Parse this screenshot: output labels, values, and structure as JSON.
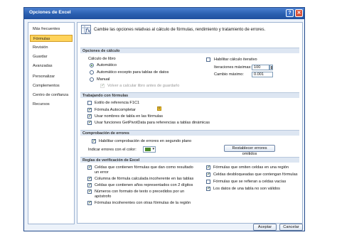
{
  "window": {
    "title": "Opciones de Excel",
    "help_icon": "?",
    "close_icon": "✕"
  },
  "sidebar": {
    "items": [
      {
        "label": "Más frecuentes"
      },
      {
        "label": "Fórmulas"
      },
      {
        "label": "Revisión"
      },
      {
        "label": "Guardar"
      },
      {
        "label": "Avanzadas"
      },
      {
        "label": "Personalizar"
      },
      {
        "label": "Complementos"
      },
      {
        "label": "Centro de confianza"
      },
      {
        "label": "Recursos"
      }
    ]
  },
  "header": {
    "text": "Cambie las opciones relativas al cálculo de fórmulas, rendimiento y tratamiento de errores."
  },
  "calc": {
    "section": "Opciones de cálculo",
    "group_label": "Cálculo de libro",
    "auto": "Automático",
    "auto_except": "Automático excepto para tablas de datos",
    "manual": "Manual",
    "recalc": "Volver a calcular libro antes de guardarlo",
    "iterative": "Habilitar cálculo iterativo",
    "max_iter_label": "Iteraciones máximas:",
    "max_iter_value": "100",
    "max_change_label": "Cambio máximo:",
    "max_change_value": "0.001"
  },
  "formulas": {
    "section": "Trabajando con fórmulas",
    "items": [
      {
        "label": "Estilo de referencia F1C1",
        "checked": false
      },
      {
        "label": "Fórmula Autocompletar",
        "checked": true
      },
      {
        "label": "Usar nombres de tabla en las fórmulas",
        "checked": true
      },
      {
        "label": "Usar funciones GetPivotData para referencias a tablas dinámicas",
        "checked": true
      }
    ]
  },
  "errors": {
    "section": "Comprobación de errores",
    "enable": "Habilitar comprobación de errores en segundo plano",
    "color_label": "Indicar errores con el color:",
    "reset_button": "Restablecer errores omitidos"
  },
  "rules": {
    "section": "Reglas de verificación de Excel",
    "left": [
      {
        "label": "Celdas que contienen fórmulas que dan como resultado",
        "label2": "un error",
        "checked": true
      },
      {
        "label": "Columna de fórmula calculada incoherente en las tablas",
        "checked": true
      },
      {
        "label": "Celdas que contienen años representados con 2 dígitos",
        "checked": true
      },
      {
        "label": "Números con formato de texto o precedidos por un",
        "label2": "apóstrofo",
        "checked": true
      },
      {
        "label": "Fórmulas incoherentes con otras fórmulas de la región",
        "checked": true
      }
    ],
    "right": [
      {
        "label": "Fórmulas que omiten celdas en una región",
        "checked": true
      },
      {
        "label": "Celdas desbloqueadas que contengan fórmulas",
        "checked": true
      },
      {
        "label": "Fórmulas que se refieran a celdas vacías",
        "checked": false
      },
      {
        "label": "Los datos de una tabla no son válidos",
        "checked": true
      }
    ]
  },
  "footer": {
    "ok": "Aceptar",
    "cancel": "Cancelar"
  }
}
